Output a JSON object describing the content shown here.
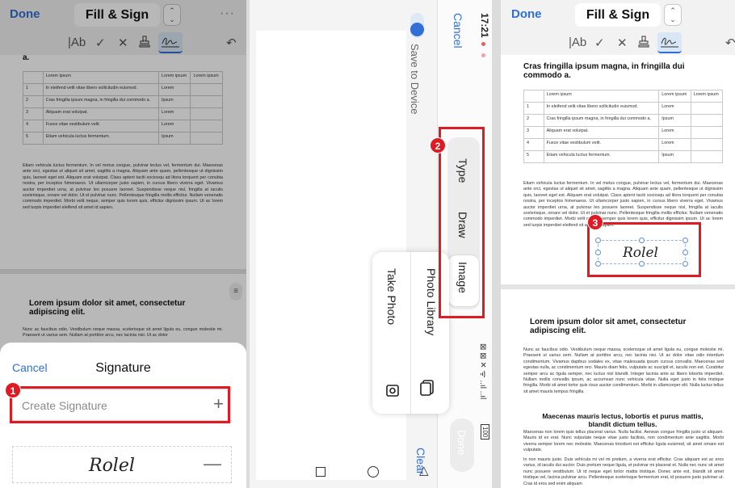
{
  "toolbar": {
    "done": "Done",
    "title": "Fill & Sign",
    "more": "···",
    "text_tool": "|Ab",
    "check_tool": "✓",
    "cross_tool": "✕",
    "undo": "↶"
  },
  "doc": {
    "heading1": "Cras fringilla ipsum magna, in fringilla dui commodo a.",
    "heading1_fragment": "a.",
    "table_header": [
      "",
      "Lorem ipsum",
      "Lorem ipsum",
      "Lorem ipsum"
    ],
    "table_rows": [
      [
        "1",
        "In eleifend velit vitae libero sollicitudin euismod.",
        "Lorem",
        ""
      ],
      [
        "2",
        "Cras fringilla ipsum magna, in fringilla dui commodo a.",
        "Ipsum",
        ""
      ],
      [
        "3",
        "Aliquam erat volutpat.",
        "Lorem",
        ""
      ],
      [
        "4",
        "Fusce vitae vestibulum velit.",
        "Lorem",
        ""
      ],
      [
        "5",
        "Etiam vehicula luctus fermentum.",
        "Ipsum",
        ""
      ]
    ],
    "para1": "Etiam vehicula luctus fermentum. In vel metus congue, pulvinar lectus vel, fermentum dui. Maecenas ante orci, egestas ut aliquet sit amet, sagittis a magna. Aliquam ante quam, pellentesque ut dignissim quis, laoreet eget est. Aliquam erat volutpat. Class aptent taciti sociosqu ad litora torquent per conubia nostra, per inceptos himenaeos. Ut ullamcorper justo sapien, in cursus libero viverra eget. Vivamus auctor imperdiet urna, at pulvinar leo posuere laoreet. Suspendisse neque nisl, fringilla at iaculis scelerisque, ornare vel dolor. Ut et pulvinar nunc. Pellentesque fringilla mollis efficitur. Nullam venenatis commodo imperdiet. Morbi velit neque, semper quis lorem quis, efficitur dignissim ipsum. Ut ac lorem sed turpis imperdiet eleifend sit amet id sapien.",
    "heading2": "Lorem ipsum dolor sit amet, consectetur adipiscing elit.",
    "para2": "Nunc ac faucibus odio. Vestibulum neque massa, scelerisque sit amet ligula eu, congue molestie mi. Praesent ut varius sem. Nullam at porttitor arcu, nec lacinia nisi. Ut ac dolor vitae odio interdum condimentum. Vivamus dapibus sodales ex, vitae malesuada ipsum cursus convallis. Maecenas sed egestas nulla, ac condimentum orci. Mauris diam felis, vulputate ac suscipit et, iaculis non est. Curabitur semper arcu ac ligula semper, nec luctus nisl blandit. Integer lacinia ante ac libero lobortis imperdiet. Nullam mollis convallis ipsum, ac accumsan nunc vehicula vitae. Nulla eget justo in felis tristique fringilla. Morbi sit amet tortor quis risus auctor condimentum. Morbi in ullamcorper elit. Nulla luctus tellus sit amet mauris tempus fringilla.",
    "para2_short": "Nunc ac faucibus odio. Vestibulum neque massa, scelerisque sit amet ligula eu, congue molestie mi. Praesent ut varius sem. Nullam at porttitor arcu, nec lacinia nisi. Ut ac dolor",
    "heading3": "Maecenas mauris lectus, lobortis et purus mattis, blandit dictum tellus.",
    "para3": "Maecenas non lorem quis tellus placerat varius. Nulla facilisi. Aenean congue fringilla justo ut aliquam. Mauris id ex erat. Nunc vulputate neque vitae justo facilisis, non condimentum ante sagittis. Morbi viverra semper lorem nec molestie. Maecenas tincidunt est efficitur ligula euismod, sit amet ornare est vulputate.",
    "para4": "In non mauris justo. Duis vehicula mi vel mi pretium, a viverra erat efficitur. Cras aliquam est ac eros varius, id iaculis dui auctor. Duis pretium neque ligula, et pulvinar mi placerat et. Nulla nec nunc sit amet nunc posuere vestibulum. Ut id neque eget tortor mattis tristique. Donec ante est, blandit sit amet tristique vel, lacinia pulvinar arcu. Pellentesque scelerisque fermentum erat, id posuere justo pulvinar ut. Cras id eros sed enim aliquam"
  },
  "signature_sheet": {
    "cancel": "Cancel",
    "title": "Signature",
    "create": "Create Signature",
    "plus": "+",
    "minus": "—",
    "saved_signature_text": "Rolel"
  },
  "creator": {
    "cancel": "Cancel",
    "save_to_device": "Save to Device",
    "tabs": [
      "Type",
      "Draw",
      "Image"
    ],
    "selected_tab": "Image",
    "menu": {
      "photo_library": "Photo Library",
      "take_photo": "Take Photo"
    },
    "done": "Done",
    "clear": "Clear",
    "status_time": "17:21",
    "status_icons": "⊠ ⊠ ✕ ᯤ ..ıl ..ıl",
    "battery": "100"
  },
  "placed_signature": {
    "text": "Rolel"
  },
  "annotations": {
    "step1": "1",
    "step2": "2",
    "step3": "3"
  },
  "colors": {
    "accent": "#2f6fd6",
    "highlight": "#e01a22"
  }
}
